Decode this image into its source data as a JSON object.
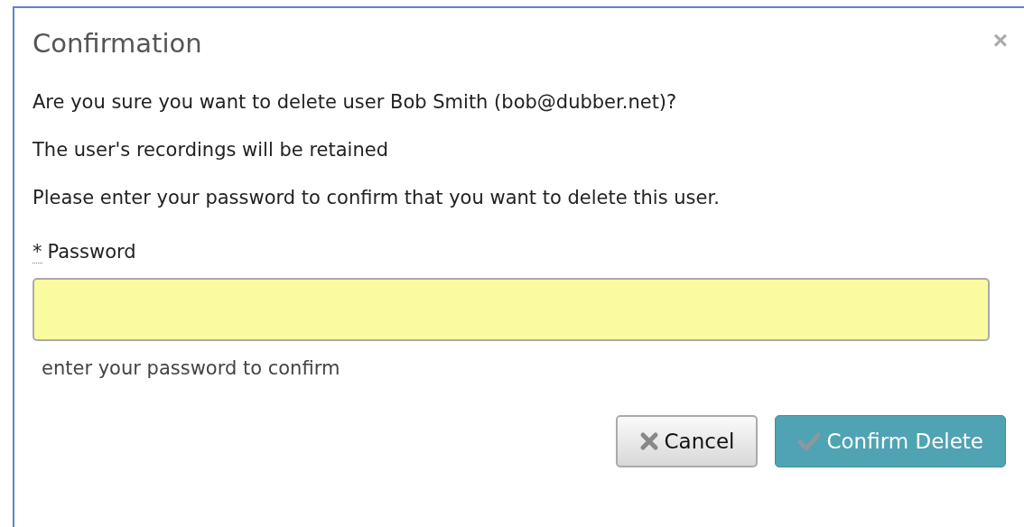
{
  "dialog": {
    "title": "Confirmation",
    "close": "×",
    "messages": [
      "Are you sure you want to delete user Bob Smith (bob@dubber.net)?",
      "The user's recordings will be retained",
      "Please enter your password to confirm that you want to delete this user."
    ],
    "field": {
      "required_mark": "*",
      "label": "Password",
      "help": "enter your password to confirm"
    },
    "buttons": [
      {
        "kind": "cancel",
        "label": "Cancel"
      },
      {
        "kind": "confirm",
        "label": "Confirm Delete"
      }
    ]
  }
}
